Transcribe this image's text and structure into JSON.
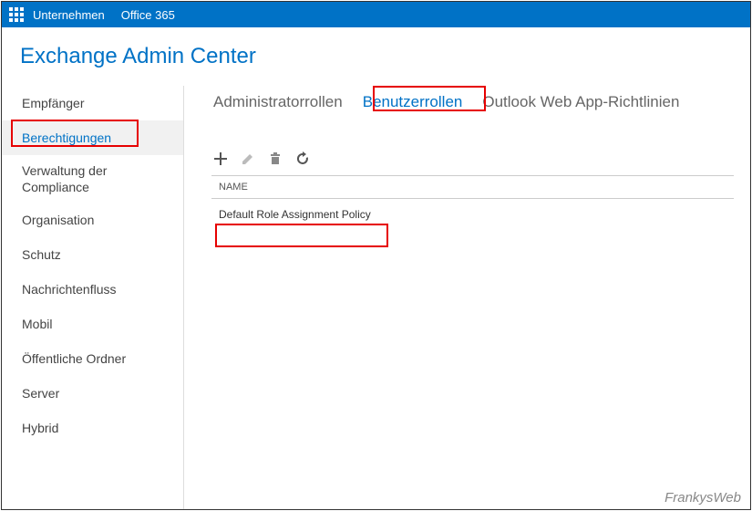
{
  "topnav": {
    "items": [
      {
        "label": "Unternehmen"
      },
      {
        "label": "Office 365"
      }
    ]
  },
  "header": {
    "title": "Exchange Admin Center"
  },
  "sidebar": {
    "items": [
      {
        "label": "Empfänger"
      },
      {
        "label": "Berechtigungen",
        "active": true
      },
      {
        "label": "Verwaltung der Compliance",
        "wrap": true
      },
      {
        "label": "Organisation"
      },
      {
        "label": "Schutz"
      },
      {
        "label": "Nachrichtenfluss"
      },
      {
        "label": "Mobil"
      },
      {
        "label": "Öffentliche Ordner"
      },
      {
        "label": "Server"
      },
      {
        "label": "Hybrid"
      }
    ]
  },
  "tabs": {
    "items": [
      {
        "label": "Administratorrollen"
      },
      {
        "label": "Benutzerrollen",
        "active": true
      },
      {
        "label": "Outlook Web App-Richtlinien"
      }
    ]
  },
  "toolbar": {
    "add": "add",
    "edit": "edit",
    "delete": "delete",
    "refresh": "refresh"
  },
  "table": {
    "columns": {
      "name": "NAME"
    },
    "rows": [
      {
        "name": "Default Role Assignment Policy"
      }
    ]
  },
  "watermark": "FrankysWeb"
}
